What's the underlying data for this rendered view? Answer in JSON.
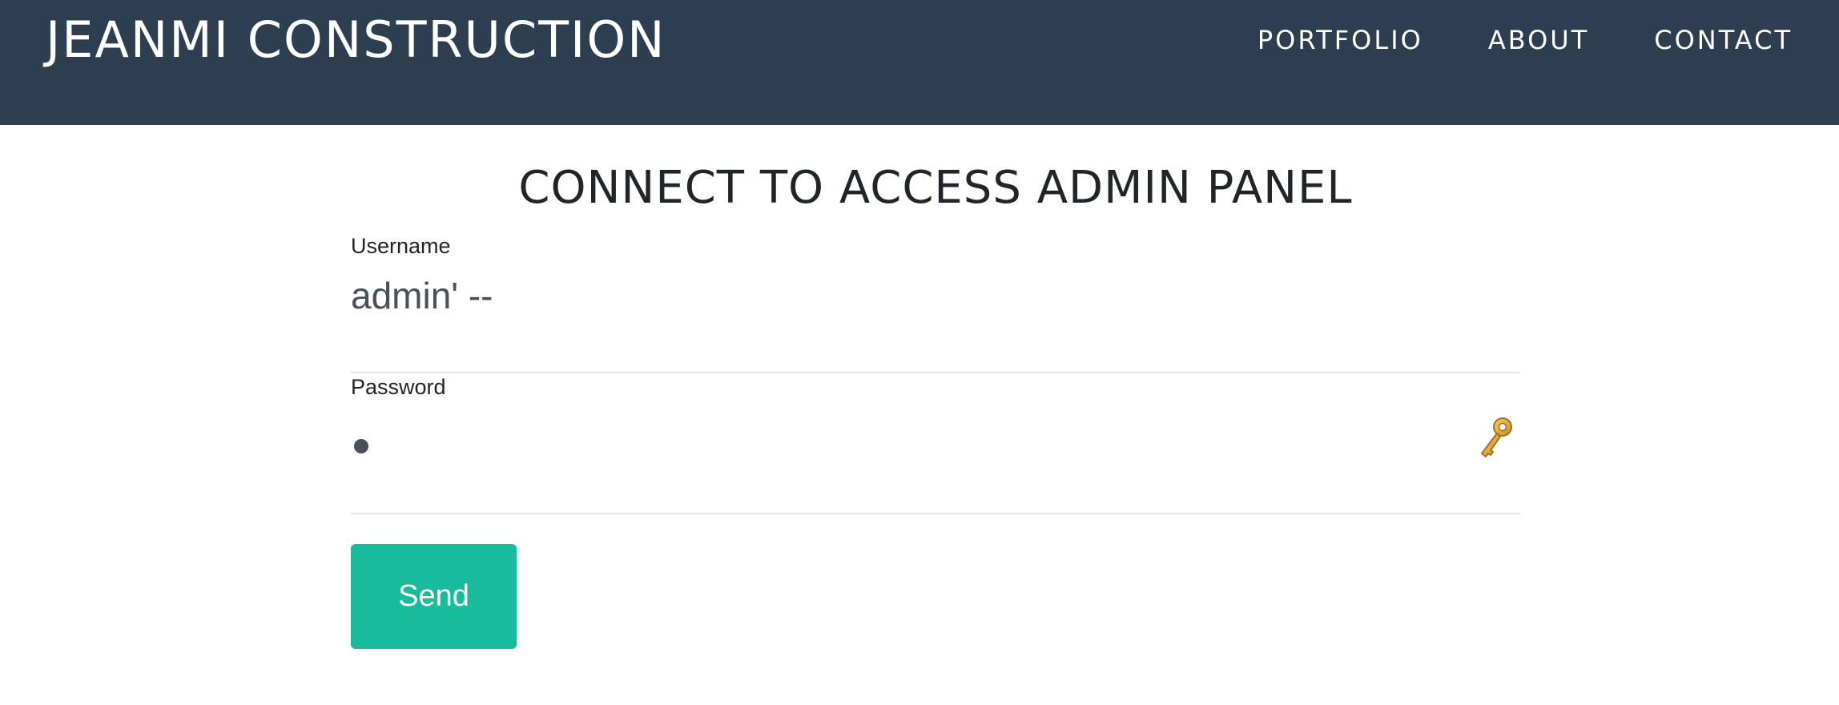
{
  "navbar": {
    "brand": "JEANMI CONSTRUCTION",
    "links": [
      {
        "label": "PORTFOLIO"
      },
      {
        "label": "ABOUT"
      },
      {
        "label": "CONTACT"
      }
    ]
  },
  "main": {
    "title": "CONNECT TO ACCESS ADMIN PANEL",
    "username": {
      "label": "Username",
      "value": "admin' --"
    },
    "password": {
      "label": "Password",
      "masked_value": "•"
    },
    "send_label": "Send"
  },
  "colors": {
    "navbar_bg": "#2c3e50",
    "accent": "#18bc9c"
  },
  "icons": {
    "password_manager": "key-icon"
  }
}
